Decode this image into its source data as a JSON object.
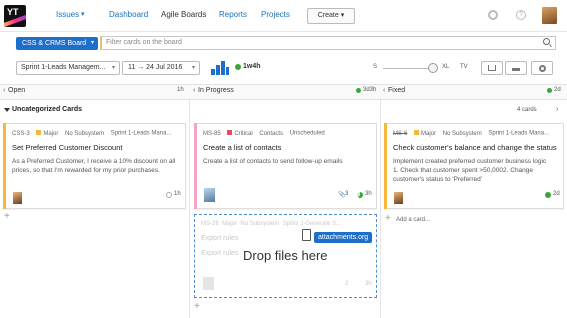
{
  "nav": {
    "logo_text": "YT",
    "issues": "Issues",
    "dashboard": "Dashboard",
    "agile_boards": "Agile Boards",
    "reports": "Reports",
    "projects": "Projects",
    "create": "Create",
    "icons": [
      "settings-icon",
      "help-icon",
      "user-avatar"
    ]
  },
  "search": {
    "board": "CSS & CRMS Board",
    "placeholder": "Filter cards on the board"
  },
  "toolbar": {
    "sprint": "Sprint 1-Leads Managem...",
    "dates": "11 → 24 Jul 2016",
    "burndown_time": "1w4h",
    "size_labels": [
      "S",
      "XL",
      "TV"
    ],
    "size_level": 0.9
  },
  "columns": [
    {
      "name": "Open",
      "count": "1h"
    },
    {
      "name": "In Progress",
      "count": "3d3h"
    },
    {
      "name": "Fixed",
      "count": "2d"
    }
  ],
  "swimlane": {
    "title": "Uncategorized Cards",
    "count": "4 cards"
  },
  "cards": [
    {
      "id": "CSS-3",
      "priority": "Major",
      "subsystem": "No Subsystem",
      "sprint": "Sprint 1-Leads Mana...",
      "title": "Set Preferred Customer Discount",
      "desc": "As a Preferred Customer, I receive a 10% discount on all prices, so that I'm rewarded for my prior purchases.",
      "time": "1h",
      "priority_color": "#f6b73c",
      "bar_color": "#f6b73c"
    },
    {
      "id": "MS-85",
      "priority": "Critical",
      "subsystem": "Contacts",
      "sprint": "Unscheduled",
      "title": "Create a list of contacts",
      "desc": "Create a list of contacts to send follow-up emails",
      "attachments": "3",
      "time": "3h",
      "priority_color": "#e84a5f",
      "bar_color": "#f3a6c8"
    },
    {
      "id": "MS-6",
      "priority": "Major",
      "subsystem": "No Subsystem",
      "sprint": "Sprint 1-Leads Mana...",
      "title": "Check customer's balance and change the status",
      "desc": "Implement created preferred customer business logic\n1. Check that customer spent >50,0002. Change customer's status to 'Preferred'",
      "time": "2d",
      "priority_color": "#f6b73c",
      "bar_color": "#f6b73c"
    }
  ],
  "ghost_card": {
    "id": "MS-28",
    "priority": "Major",
    "subsystem": "No Subsystem",
    "sprint": "Sprint 2-Generate S...",
    "title": "Export rules",
    "title2": "Export rules",
    "attachments": "2",
    "time": "3h"
  },
  "drop": {
    "text": "Drop files here",
    "badge": "attachments.org"
  },
  "add_card": "Add a card..."
}
